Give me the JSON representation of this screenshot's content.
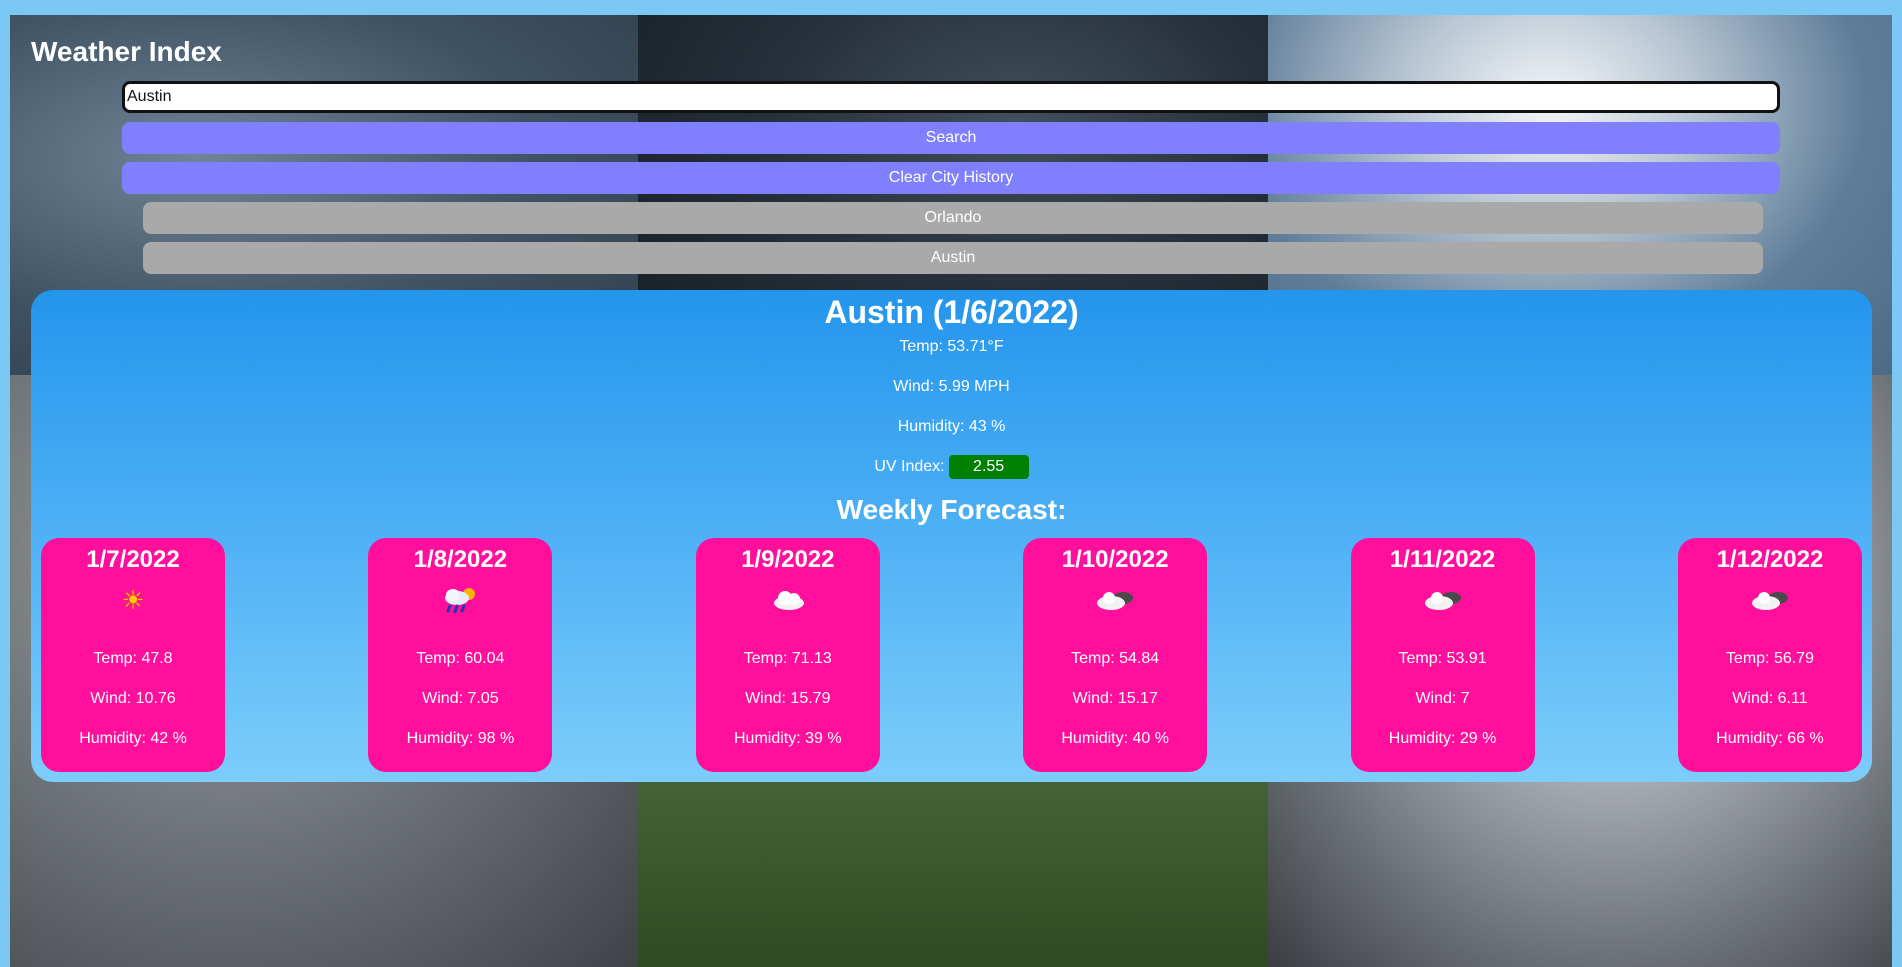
{
  "app": {
    "title": "Weather Index"
  },
  "search": {
    "value": "Austin",
    "button_label": "Search",
    "clear_label": "Clear City History"
  },
  "history": [
    "Orlando",
    "Austin"
  ],
  "current": {
    "title": "Austin (1/6/2022)",
    "temp": "Temp: 53.71°F",
    "wind": "Wind: 5.99 MPH",
    "humidity": "Humidity: 43 %",
    "uv_label": "UV Index:",
    "uv_value": "2.55",
    "uv_color": "#008000"
  },
  "weekly_title": "Weekly Forecast:",
  "forecast": [
    {
      "date": "1/7/2022",
      "icon": "sun-icon",
      "temp": "Temp: 47.8",
      "wind": "Wind: 10.76",
      "humidity": "Humidity: 42 %"
    },
    {
      "date": "1/8/2022",
      "icon": "rain-sun-icon",
      "temp": "Temp: 60.04",
      "wind": "Wind: 7.05",
      "humidity": "Humidity: 98 %"
    },
    {
      "date": "1/9/2022",
      "icon": "cloud-icon",
      "temp": "Temp: 71.13",
      "wind": "Wind: 15.79",
      "humidity": "Humidity: 39 %"
    },
    {
      "date": "1/10/2022",
      "icon": "broken-clouds-icon",
      "temp": "Temp: 54.84",
      "wind": "Wind: 15.17",
      "humidity": "Humidity: 40 %"
    },
    {
      "date": "1/11/2022",
      "icon": "broken-clouds-icon",
      "temp": "Temp: 53.91",
      "wind": "Wind: 7",
      "humidity": "Humidity: 29 %"
    },
    {
      "date": "1/12/2022",
      "icon": "broken-clouds-icon",
      "temp": "Temp: 56.79",
      "wind": "Wind: 6.11",
      "humidity": "Humidity: 66 %"
    }
  ],
  "colors": {
    "primary_button": "#8080ff",
    "history_button": "#a9a9a9",
    "card_background": "#ff0f9b"
  }
}
